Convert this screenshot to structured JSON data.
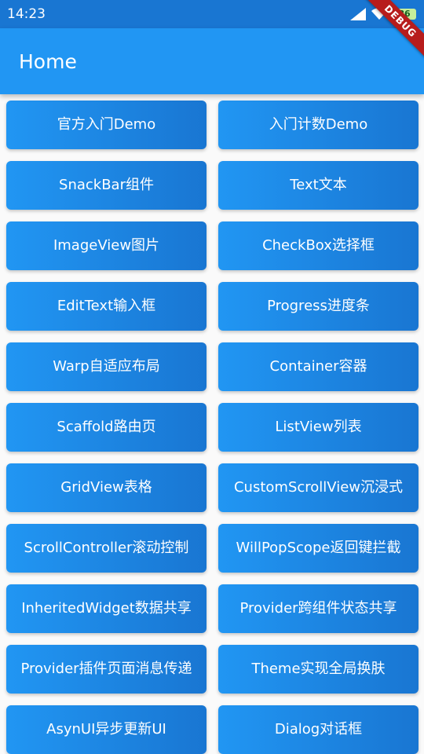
{
  "status_bar": {
    "time": "14:23",
    "battery": "86",
    "icons": [
      "signal-icon",
      "wifi-icon",
      "battery-icon"
    ]
  },
  "app_bar": {
    "title": "Home",
    "background": "#2196F3"
  },
  "debug_banner": "DEBUG",
  "buttons": [
    "官方入门Demo",
    "入门计数Demo",
    "SnackBar组件",
    "Text文本",
    "ImageView图片",
    "CheckBox选择框",
    "EditText输入框",
    "Progress进度条",
    "Warp自适应布局",
    "Container容器",
    "Scaffold路由页",
    "ListView列表",
    "GridView表格",
    "CustomScrollView沉浸式",
    "ScrollController滚动控制",
    "WillPopScope返回键拦截",
    "InheritedWidget数据共享",
    "Provider跨组件状态共享",
    "Provider插件页面消息传递",
    "Theme实现全局换肤",
    "AsynUI异步更新UI",
    "Dialog对话框"
  ],
  "colors": {
    "primary": "#2196F3",
    "primary_dark": "#1976D2",
    "text_on_primary": "#FFFFFF",
    "background": "#FAFAFA"
  }
}
